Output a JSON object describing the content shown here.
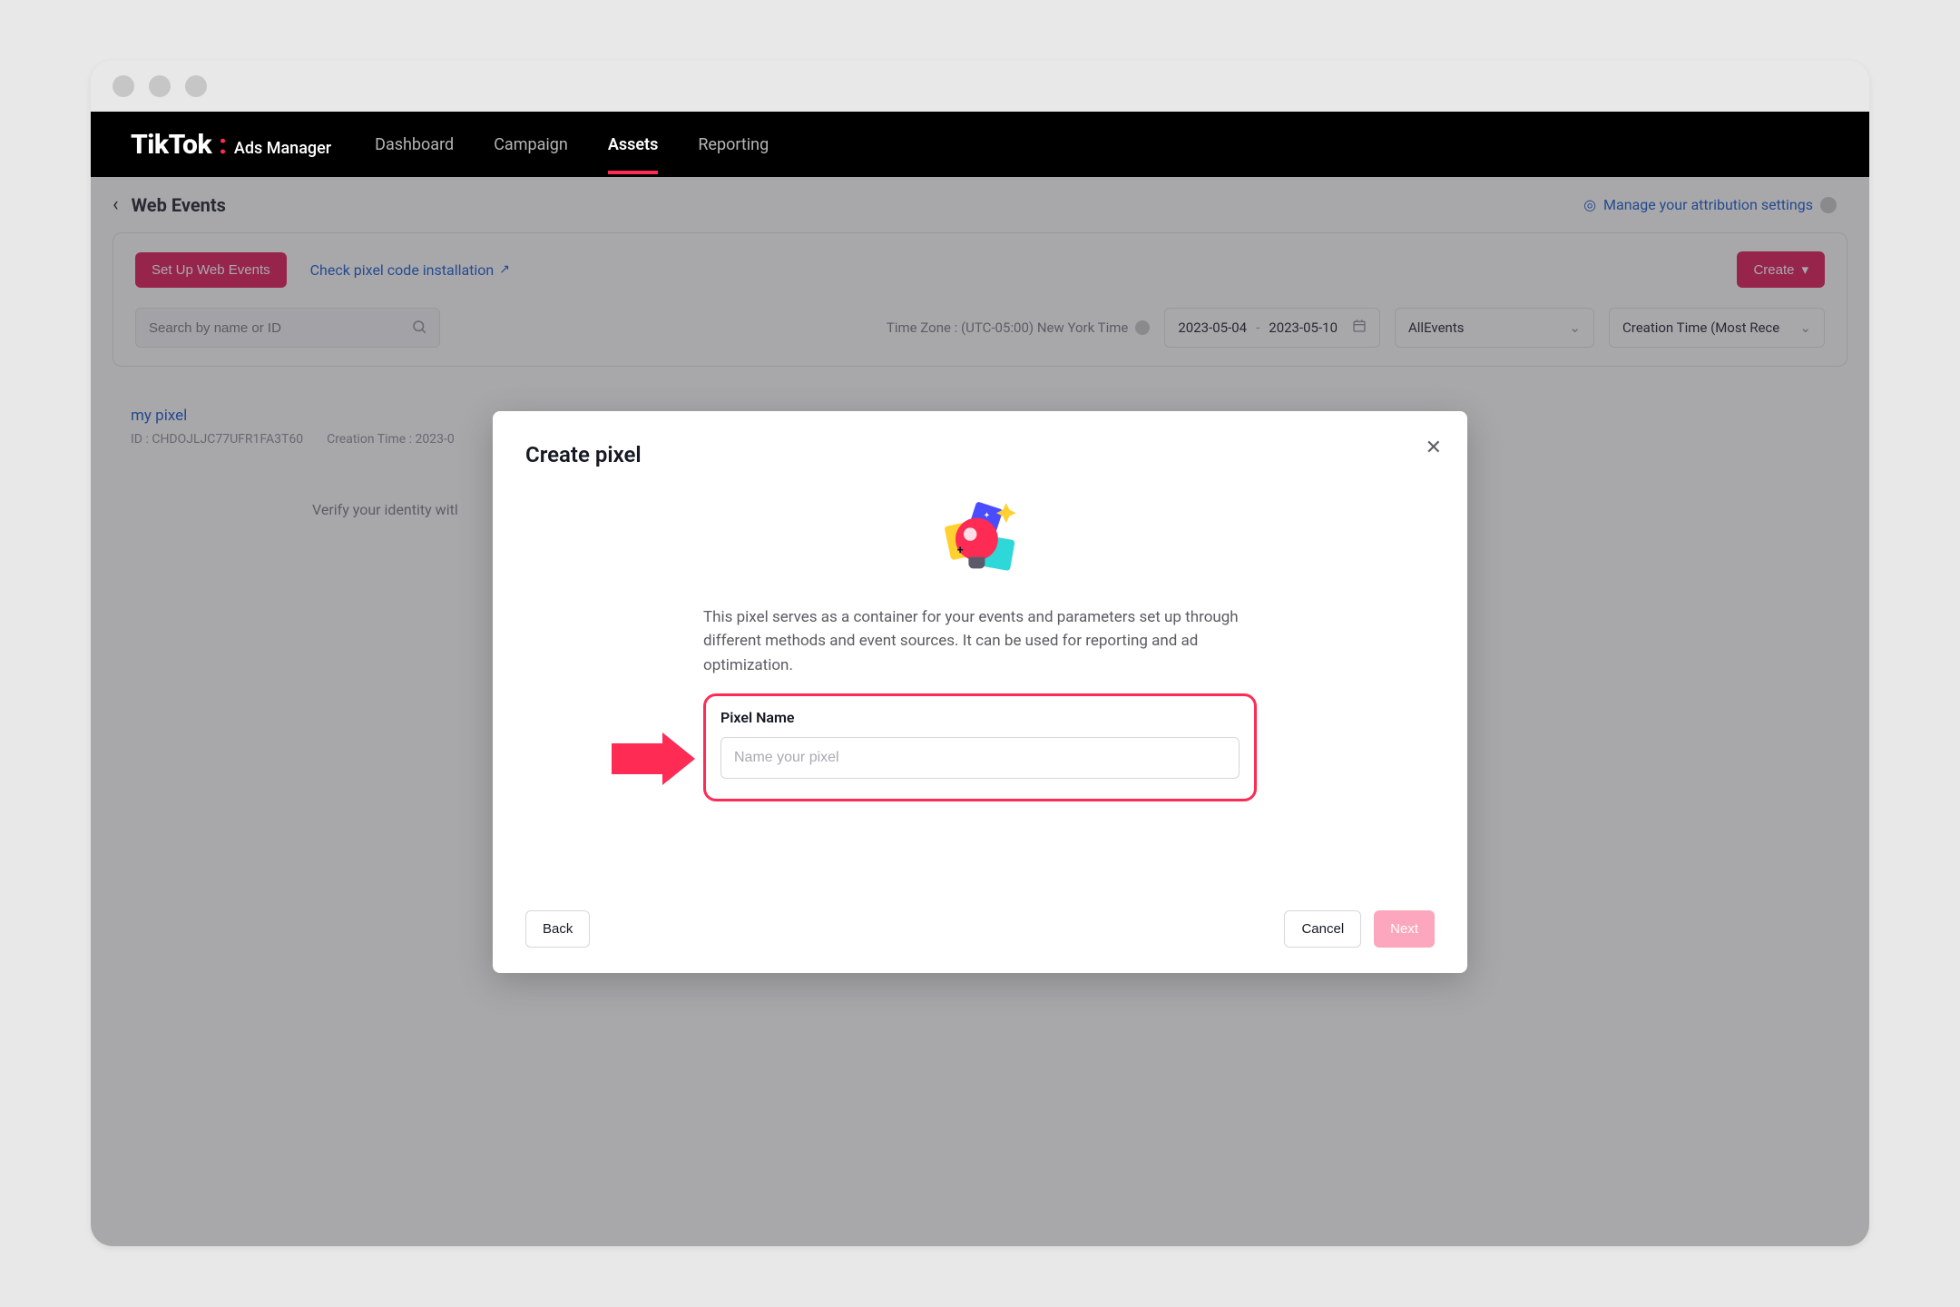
{
  "brand": {
    "logo": "TikTok",
    "suffix": "Ads Manager"
  },
  "nav": {
    "items": [
      {
        "label": "Dashboard",
        "active": false
      },
      {
        "label": "Campaign",
        "active": false
      },
      {
        "label": "Assets",
        "active": true
      },
      {
        "label": "Reporting",
        "active": false
      }
    ]
  },
  "page": {
    "title": "Web Events",
    "attribution_link": "Manage your attribution settings"
  },
  "toolbar": {
    "setup_btn": "Set Up Web Events",
    "check_link": "Check pixel code installation",
    "create_btn": "Create",
    "search_placeholder": "Search by name or ID",
    "timezone_label": "Time Zone : (UTC-05:00) New York Time",
    "date_start": "2023-05-04",
    "date_end": "2023-05-10",
    "events_filter": "AllEvents",
    "sort_label": "Creation Time (Most Rece"
  },
  "pixel_list": {
    "items": [
      {
        "name": "my pixel",
        "id_label": "ID : CHDOJLJC77UFR1FA3T60",
        "creation_label": "Creation Time : 2023-0"
      }
    ],
    "identity_banner": "Verify your identity witl"
  },
  "modal": {
    "title": "Create pixel",
    "description": "This pixel serves as a container for your events and parameters set up through different methods and event sources. It can be used for reporting and ad optimization.",
    "field_label": "Pixel Name",
    "field_placeholder": "Name your pixel",
    "back_btn": "Back",
    "cancel_btn": "Cancel",
    "next_btn": "Next"
  },
  "colors": {
    "accent": "#fe2c55",
    "primary_btn": "#e11251",
    "link": "#1254cc"
  }
}
